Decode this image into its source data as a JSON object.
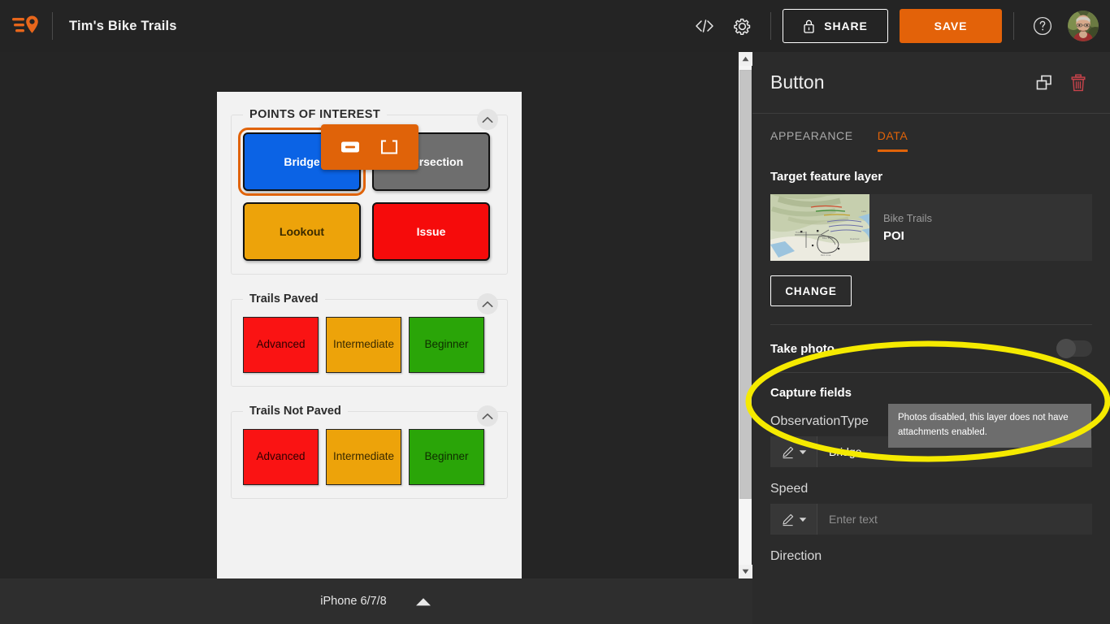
{
  "topbar": {
    "logo_icon": "trails-menu-pin-icon",
    "app_title": "Tim's Bike Trails",
    "code_icon": "code-brackets-icon",
    "settings_icon": "gear-icon",
    "share_label": "SHARE",
    "share_icon": "lock-icon",
    "save_label": "SAVE",
    "help_icon": "question-circle-icon",
    "avatar_icon": "user-avatar"
  },
  "canvas": {
    "float_toolbar": {
      "button_tool_icon": "button-widget-icon",
      "group_tool_icon": "group-widget-icon"
    },
    "sections": [
      {
        "title": "POINTS OF INTEREST",
        "uppercase": true,
        "collapse_icon": "chevron-up-icon",
        "layout": "poi",
        "buttons": [
          {
            "label": "Bridge",
            "bg": "#0b63e5",
            "text_color": "#ffffff",
            "selected": true
          },
          {
            "label": "Intersection",
            "bg": "#6e6e6e",
            "text_color": "#ffffff",
            "selected": false
          },
          {
            "label": "Lookout",
            "bg": "#eda30a",
            "text_color": "#3a2a00",
            "selected": false
          },
          {
            "label": "Issue",
            "bg": "#f60b0b",
            "text_color": "#ffffff",
            "selected": false
          }
        ]
      },
      {
        "title": "Trails Paved",
        "uppercase": false,
        "collapse_icon": "chevron-up-icon",
        "layout": "trail",
        "buttons": [
          {
            "label": "Advanced",
            "bg": "#fa1313",
            "text_color": "#2d0000",
            "selected": false
          },
          {
            "label": "Intermediate",
            "bg": "#eda30a",
            "text_color": "#3a2a00",
            "selected": false
          },
          {
            "label": "Beginner",
            "bg": "#2aa508",
            "text_color": "#0e2d00",
            "selected": false
          }
        ]
      },
      {
        "title": "Trails Not Paved",
        "uppercase": false,
        "collapse_icon": "chevron-up-icon",
        "layout": "trail",
        "buttons": [
          {
            "label": "Advanced",
            "bg": "#fa1313",
            "text_color": "#2d0000",
            "selected": false
          },
          {
            "label": "Intermediate",
            "bg": "#eda30a",
            "text_color": "#3a2a00",
            "selected": false
          },
          {
            "label": "Beginner",
            "bg": "#2aa508",
            "text_color": "#0e2d00",
            "selected": false
          }
        ]
      }
    ],
    "scrollbar": {
      "up_arrow_icon": "scroll-up-arrow-icon",
      "down_arrow_icon": "scroll-down-arrow-icon"
    }
  },
  "bottombar": {
    "device_label": "iPhone 6/7/8",
    "caret_icon": "caret-up-icon"
  },
  "panel": {
    "title": "Button",
    "duplicate_icon": "duplicate-icon",
    "delete_icon": "trash-icon",
    "tabs": [
      {
        "label": "APPEARANCE",
        "active": false
      },
      {
        "label": "DATA",
        "active": true
      }
    ],
    "target_layer": {
      "section_label": "Target feature layer",
      "thumb_icon": "map-thumbnail",
      "layer_name": "Bike Trails",
      "sublayer_name": "POI",
      "change_label": "CHANGE"
    },
    "take_photo": {
      "label": "Take photo",
      "toggle_state": "off",
      "toggle_icon": "toggle-switch-off"
    },
    "tooltip": {
      "text": "Photos disabled, this layer does not have attachments enabled."
    },
    "capture_fields": {
      "label": "Capture fields",
      "fields": [
        {
          "label": "ObservationType",
          "selector_icon": "pencil-icon",
          "caret_icon": "caret-down-icon",
          "value": "Bridge",
          "is_placeholder": false
        },
        {
          "label": "Speed",
          "selector_icon": "pencil-icon",
          "caret_icon": "caret-down-icon",
          "value": "Enter text",
          "is_placeholder": true
        },
        {
          "label": "Direction",
          "selector_icon": "pencil-icon",
          "caret_icon": "caret-down-icon",
          "value": "",
          "is_placeholder": true
        }
      ]
    }
  },
  "annotation": {
    "shape": "ellipse-highlight",
    "color": "#f5ea00"
  },
  "colors": {
    "accent": "#e06309",
    "panel_bg": "#2b2b2b",
    "canvas_bg": "#252525",
    "topbar_bg": "#242424",
    "preview_bg": "#f2f2f2",
    "danger": "#c8434b"
  }
}
